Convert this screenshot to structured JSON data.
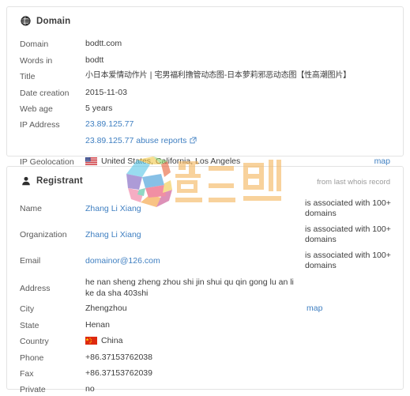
{
  "domain_card": {
    "header": {
      "title": "Domain",
      "icon": "globe-icon"
    },
    "rows": [
      {
        "label": "Domain",
        "value": "bodtt.com"
      },
      {
        "label": "Words in",
        "value": "bodtt"
      },
      {
        "label": "Title",
        "value": "小日本爱情动作片 | 宅男福利撸管动态图-日本萝莉邪恶动态图【性高潮图片】"
      },
      {
        "label": "Date creation",
        "value": "2015-11-03"
      },
      {
        "label": "Web age",
        "value": "5 years"
      },
      {
        "label": "IP Address",
        "value": "23.89.125.77"
      },
      {
        "label": "",
        "value": "23.89.125.77 abuse reports"
      },
      {
        "label": "IP Geolocation",
        "value": "United States, California, Los Angeles"
      }
    ],
    "geo_map_label": "map"
  },
  "registrant_card": {
    "header": {
      "title": "Registrant",
      "icon": "user-icon"
    },
    "note": "from last whois record",
    "rows": [
      {
        "label": "Name",
        "value": "Zhang Li Xiang",
        "assoc": "is associated with 100+ domains"
      },
      {
        "label": "Organization",
        "value": "Zhang Li Xiang",
        "assoc": "is associated with 100+ domains"
      },
      {
        "label": "Email",
        "value": "domainor@126.com",
        "assoc": "is associated with 100+ domains"
      },
      {
        "label": "Address",
        "value": "he nan sheng zheng zhou shi jin shui qu qin gong lu an li ke da sha 403shi"
      },
      {
        "label": "City",
        "value": "Zhengzhou"
      },
      {
        "label": "State",
        "value": "Henan"
      },
      {
        "label": "Country",
        "value": "China"
      },
      {
        "label": "Phone",
        "value": "+86.37153762038"
      },
      {
        "label": "Fax",
        "value": "+86.37153762039"
      },
      {
        "label": "Private",
        "value": "no"
      }
    ],
    "city_map_label": "map"
  },
  "watermark": {
    "text": "쉴드맨",
    "mark": "S",
    "text_color": "#f5b860"
  },
  "colors": {
    "link": "#3f7fc1",
    "label": "#5a5a5a",
    "value": "#3d3d3d",
    "card_border": "#e3e3e3",
    "note": "#9b9b9b"
  }
}
